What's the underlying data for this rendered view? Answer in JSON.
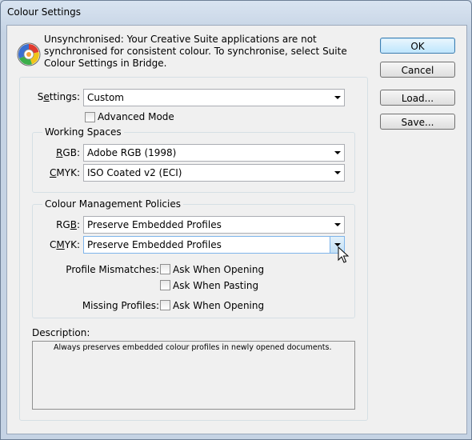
{
  "window": {
    "title": "Colour Settings"
  },
  "message": "Unsynchronised: Your Creative Suite applications are not synchronised for consistent colour. To synchronise, select Suite Colour Settings in Bridge.",
  "buttons": {
    "ok": "OK",
    "cancel": "Cancel",
    "load": "Load...",
    "save": "Save..."
  },
  "settings": {
    "label_pre": "S",
    "label_u": "e",
    "label_post": "ttings:",
    "value": "Custom",
    "advanced_label": "Advanced Mode",
    "advanced_checked": false
  },
  "working_spaces": {
    "title": "Working Spaces",
    "rgb_label_u": "R",
    "rgb_label_post": "GB:",
    "rgb_value": "Adobe RGB (1998)",
    "cmyk_label_u": "C",
    "cmyk_label_post": "MYK:",
    "cmyk_value": "ISO Coated v2 (ECI)"
  },
  "policies": {
    "title": "Colour Management Policies",
    "rgb_label_pre": "RG",
    "rgb_label_u": "B",
    "rgb_label_post": ":",
    "rgb_value": "Preserve Embedded Profiles",
    "cmyk_label_pre": "C",
    "cmyk_label_u": "M",
    "cmyk_label_post": "YK:",
    "cmyk_value": "Preserve Embedded Profiles",
    "mismatch_label": "Profile Mismatches:",
    "ask_opening": "Ask When Opening",
    "ask_pasting": "Ask When Pasting",
    "missing_label": "Missing Profiles:",
    "missing_ask_opening": "Ask When Opening"
  },
  "description": {
    "label": "Description:",
    "text": "Always preserves embedded colour profiles in newly opened documents."
  },
  "colors": {
    "accent": "#3c7fb1",
    "background": "#f0f0f0"
  }
}
